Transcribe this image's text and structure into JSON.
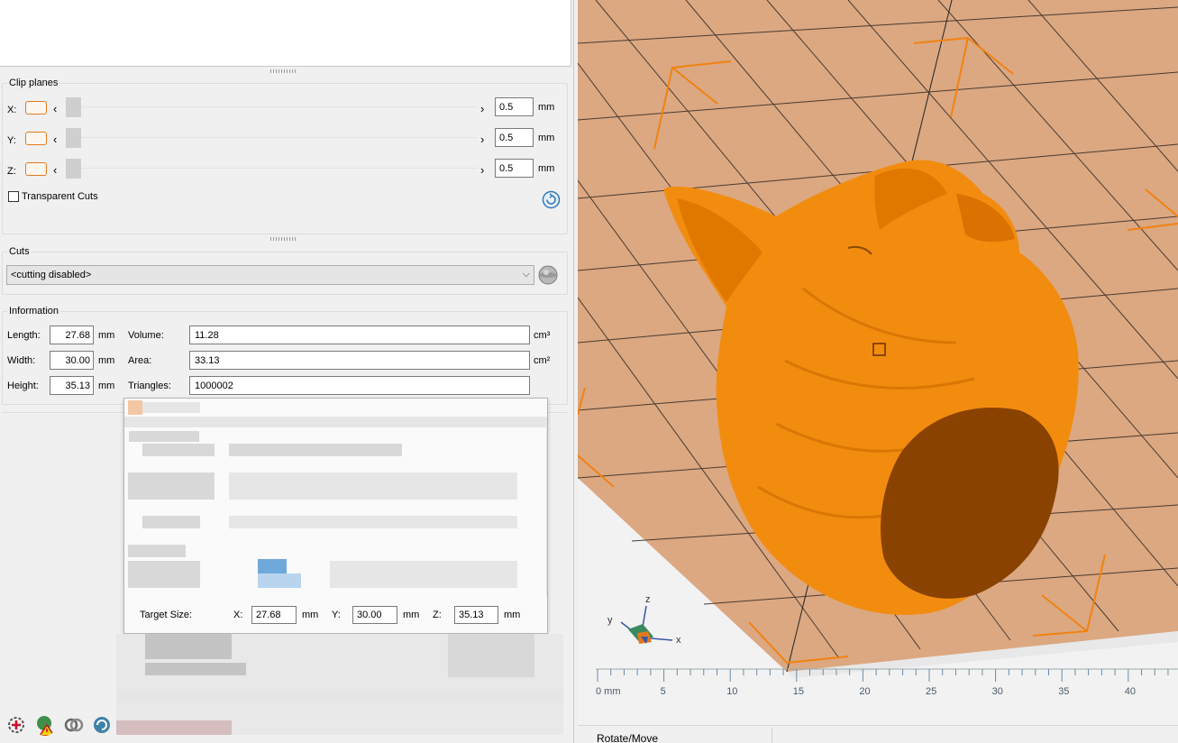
{
  "clip_planes": {
    "title": "Clip planes",
    "rows": [
      {
        "axis": "X:",
        "value": "0.5",
        "unit": "mm"
      },
      {
        "axis": "Y:",
        "value": "0.5",
        "unit": "mm"
      },
      {
        "axis": "Z:",
        "value": "0.5",
        "unit": "mm"
      }
    ],
    "transparent_cuts_label": "Transparent Cuts",
    "transparent_cuts_checked": false
  },
  "cuts": {
    "title": "Cuts",
    "selected": "<cutting disabled>"
  },
  "information": {
    "title": "Information",
    "length_label": "Length:",
    "length": "27.68",
    "width_label": "Width:",
    "width": "30.00",
    "height_label": "Height:",
    "height": "35.13",
    "dim_unit": "mm",
    "volume_label": "Volume:",
    "volume": "11.28",
    "volume_unit": "cm³",
    "area_label": "Area:",
    "area": "33.13",
    "area_unit": "cm²",
    "triangles_label": "Triangles:",
    "triangles": "1000002"
  },
  "target_size": {
    "label": "Target Size:",
    "x_label": "X:",
    "x": "27.68",
    "y_label": "Y:",
    "y": "30.00",
    "z_label": "Z:",
    "z": "35.13",
    "unit": "mm"
  },
  "ruler": {
    "ticks": [
      "0 mm",
      "5",
      "10",
      "15",
      "20",
      "25",
      "30",
      "35",
      "40"
    ]
  },
  "axes": {
    "x": "x",
    "y": "y",
    "z": "z"
  },
  "status": {
    "mode": "Rotate/Move"
  },
  "colors": {
    "model": "#f28c0f",
    "model_cut": "#8a4200",
    "bed": "#dba882",
    "accent": "#e07a1f"
  },
  "toolbar": {
    "icons": [
      "add-part-icon",
      "warning-repair-icon",
      "link-icon",
      "refresh-icon"
    ]
  }
}
